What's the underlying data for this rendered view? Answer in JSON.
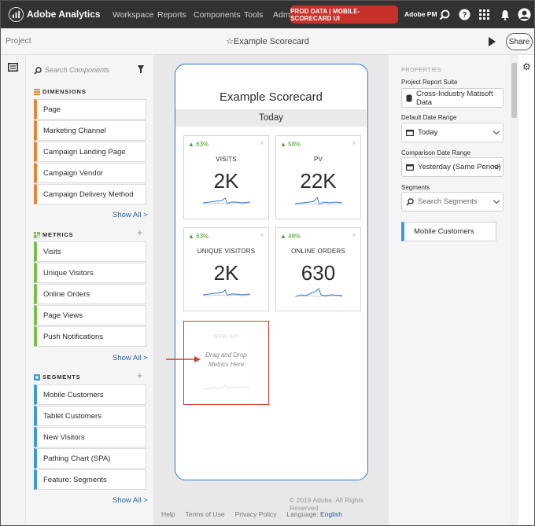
{
  "topnav": {
    "brand": "Adobe Analytics",
    "links": [
      "Workspace",
      "Reports",
      "Components",
      "Tools",
      "Admi"
    ],
    "badge": "PROD DATA | MOBILE-SCORECARD UI",
    "user": "Adobe PM",
    "icons": [
      "search-icon",
      "help-icon",
      "apps-grid-icon",
      "bell-icon",
      "avatar-icon"
    ]
  },
  "project": {
    "label": "Project",
    "title": "☆Example Scorecard",
    "share": "Share"
  },
  "components": {
    "search_placeholder": "Search Components",
    "dimensions": {
      "heading": "DIMENSIONS",
      "items": [
        "Page",
        "Marketing Channel",
        "Campaign Landing Page",
        "Campaign Vendor",
        "Campaign Delivery Method"
      ],
      "show_all": "Show All >"
    },
    "metrics": {
      "heading": "METRICS",
      "items": [
        "Visits",
        "Unique Visitors",
        "Online Orders",
        "Page Views",
        "Push Notifications"
      ],
      "show_all": "Show All >"
    },
    "segments": {
      "heading": "SEGMENTS",
      "items": [
        "Mobile Customers",
        "Tablet Customers",
        "New Visitors",
        "Pathing Chart (SPA)",
        "Feature: Segments"
      ],
      "show_all": "Show All >"
    }
  },
  "scorecard": {
    "title": "Example Scorecard",
    "date": "Today",
    "kpis": [
      {
        "change": "▲ 63%",
        "label": "VISITS",
        "value": "2K"
      },
      {
        "change": "▲ 58%",
        "label": "PV",
        "value": "22K"
      },
      {
        "change": "▲ 63%",
        "label": "UNIQUE VISITORS",
        "value": "2K"
      },
      {
        "change": "▲ 48%",
        "label": "ONLINE ORDERS",
        "value": "630"
      }
    ],
    "new_kpi": {
      "title": "NEW KPI",
      "drop_line1": "Drag and Drop",
      "drop_line2": "Metrics Here"
    },
    "close_glyph": "×"
  },
  "footer": {
    "copyright": "© 2019 Adobe. All Rights Reserved",
    "links": [
      "Help",
      "Terms of Use",
      "Privacy Policy"
    ],
    "language_label": "Language:",
    "language_value": "English"
  },
  "properties": {
    "heading": "PROPERTIES",
    "report_suite_label": "Project Report Suite",
    "report_suite_value": "Cross-Industry Matisoft Data",
    "default_date_label": "Default Date Range",
    "default_date_value": "Today",
    "comparison_label": "Comparison Date Range",
    "comparison_value": "Yesterday (Same Period)",
    "segments_label": "Segments",
    "segments_placeholder": "Search Segments",
    "applied_segment": "Mobile Customers"
  },
  "colors": {
    "nav_bg": "#323232",
    "badge_red": "#c8302a",
    "dimension_orange": "#e8833a",
    "metric_green": "#7dbd4a",
    "segment_blue": "#3d9bd8",
    "phone_border": "#2b7bd4",
    "trend_blue": "#2b7bd4",
    "callout_red": "#d43a33"
  }
}
